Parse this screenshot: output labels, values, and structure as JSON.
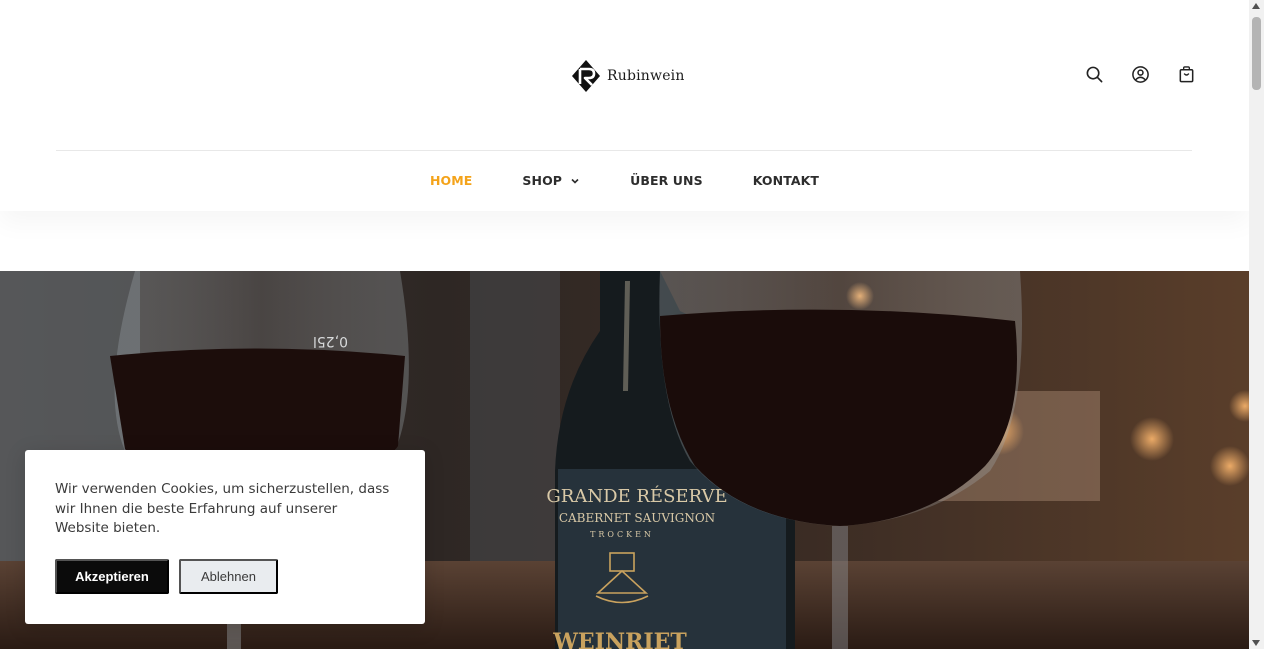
{
  "brand": {
    "name": "Rubinwein"
  },
  "header_icons": [
    {
      "name": "search-icon"
    },
    {
      "name": "account-icon"
    },
    {
      "name": "cart-icon"
    }
  ],
  "nav": {
    "items": [
      {
        "label": "HOME",
        "active": true
      },
      {
        "label": "SHOP",
        "has_dropdown": true
      },
      {
        "label": "ÜBER UNS"
      },
      {
        "label": "KONTAKT"
      }
    ]
  },
  "hero": {
    "label_lines": [
      "GRANDE RÉSERVE",
      "CABERNET SAUVIGNON",
      "TROCKEN"
    ],
    "brand_text": "WEINRIET",
    "glass_marking": "0,25l"
  },
  "cookie": {
    "text": "Wir verwenden Cookies, um sicherzustellen, dass wir Ihnen die beste Erfahrung auf unserer Website bieten.",
    "accept_label": "Akzeptieren",
    "reject_label": "Ablehnen"
  },
  "colors": {
    "accent": "#f4a31a",
    "dark": "#0b0b0b",
    "text": "#2d2d2d"
  }
}
